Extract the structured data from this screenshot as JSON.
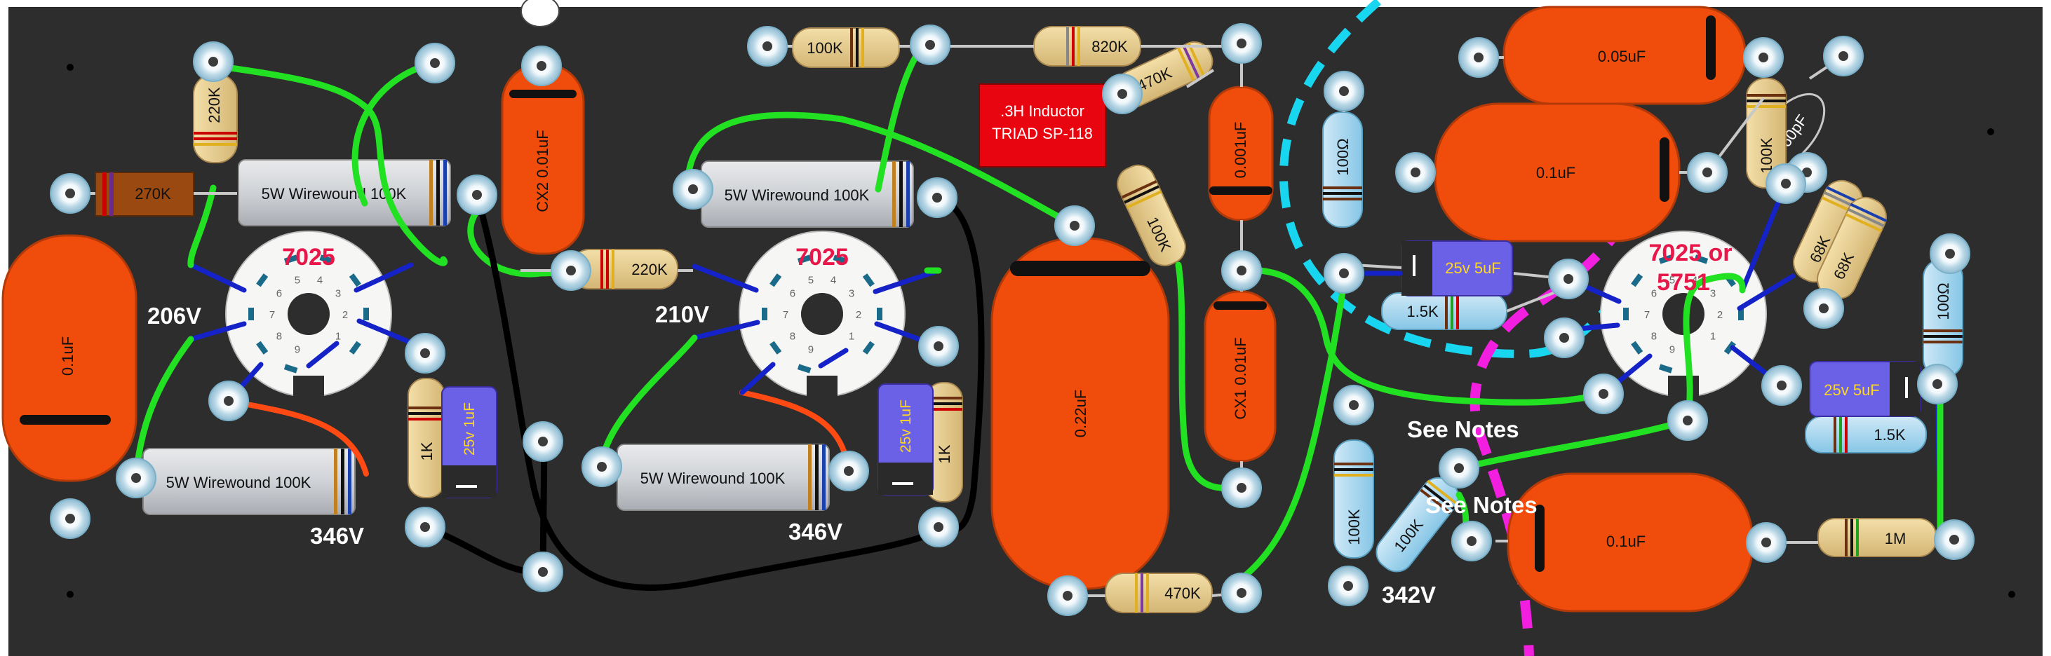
{
  "board": {
    "tubes": [
      {
        "id": "v1",
        "label": "7025"
      },
      {
        "id": "v2",
        "label": "7025"
      },
      {
        "id": "v3",
        "label_line1": "7025 or",
        "label_line2": "5751"
      }
    ],
    "pin_numbers": [
      "1",
      "2",
      "3",
      "4",
      "5",
      "6",
      "7",
      "8",
      "9"
    ],
    "voltages": {
      "v1_plate": "206V",
      "v1_supply": "346V",
      "v2_plate": "210V",
      "v2_supply": "346V",
      "v3_supply": "342V"
    },
    "caps": {
      "c_left": "0.1uF",
      "cx2": "CX2 0.01uF",
      "c_big": "0.22uF",
      "c_001": "0.001uF",
      "cx1": "CX1 0.01uF",
      "c_005": "0.05uF",
      "c_01a": "0.1uF",
      "c_01b": "0.1uF",
      "c_360": "360pF",
      "e1": "25v 1uF",
      "e2": "25v 1uF",
      "e3": "25v 5uF",
      "e4": "25v 5uF"
    },
    "resistors": {
      "r220k_v": "220K",
      "r270k": "270K",
      "ww1": "5W Wirewound 100K",
      "ww2": "5W Wirewound 100K",
      "ww3": "5W Wirewound 100K",
      "ww4": "5W Wirewound 100K",
      "r1k_a": "1K",
      "r1k_b": "1K",
      "r220k_h": "220K",
      "r100k_top": "100K",
      "r820k": "820K",
      "r470k_top": "470K",
      "r100k_diag": "100K",
      "r470k_bot": "470K",
      "r100ohm_a": "100Ω",
      "r100ohm_b": "100Ω",
      "r15k_a": "1.5K",
      "r15k_b": "1.5K",
      "r100k_v3": "100K",
      "r100k_v4": "100K",
      "r100k_diag2": "100K",
      "r68k_a": "68K",
      "r68k_b": "68K",
      "r1m": "1M"
    },
    "inductor": {
      "line1": ".3H Inductor",
      "line2": "TRIAD SP-118"
    },
    "notes": [
      "See Notes",
      "See Notes"
    ],
    "colors": {
      "board": "#2d2d2d",
      "wire_green": "#22e022",
      "wire_black": "#000000",
      "wire_blue": "#1522c8",
      "wire_orange": "#ff4a14",
      "cap_orange": "#f04c0c",
      "elec_cap": "#6a61e6",
      "inductor": "#e8050f",
      "shield_cyan": "#19d6f0",
      "shield_magenta": "#f21ee0",
      "tube_label": "#e8174a"
    }
  }
}
